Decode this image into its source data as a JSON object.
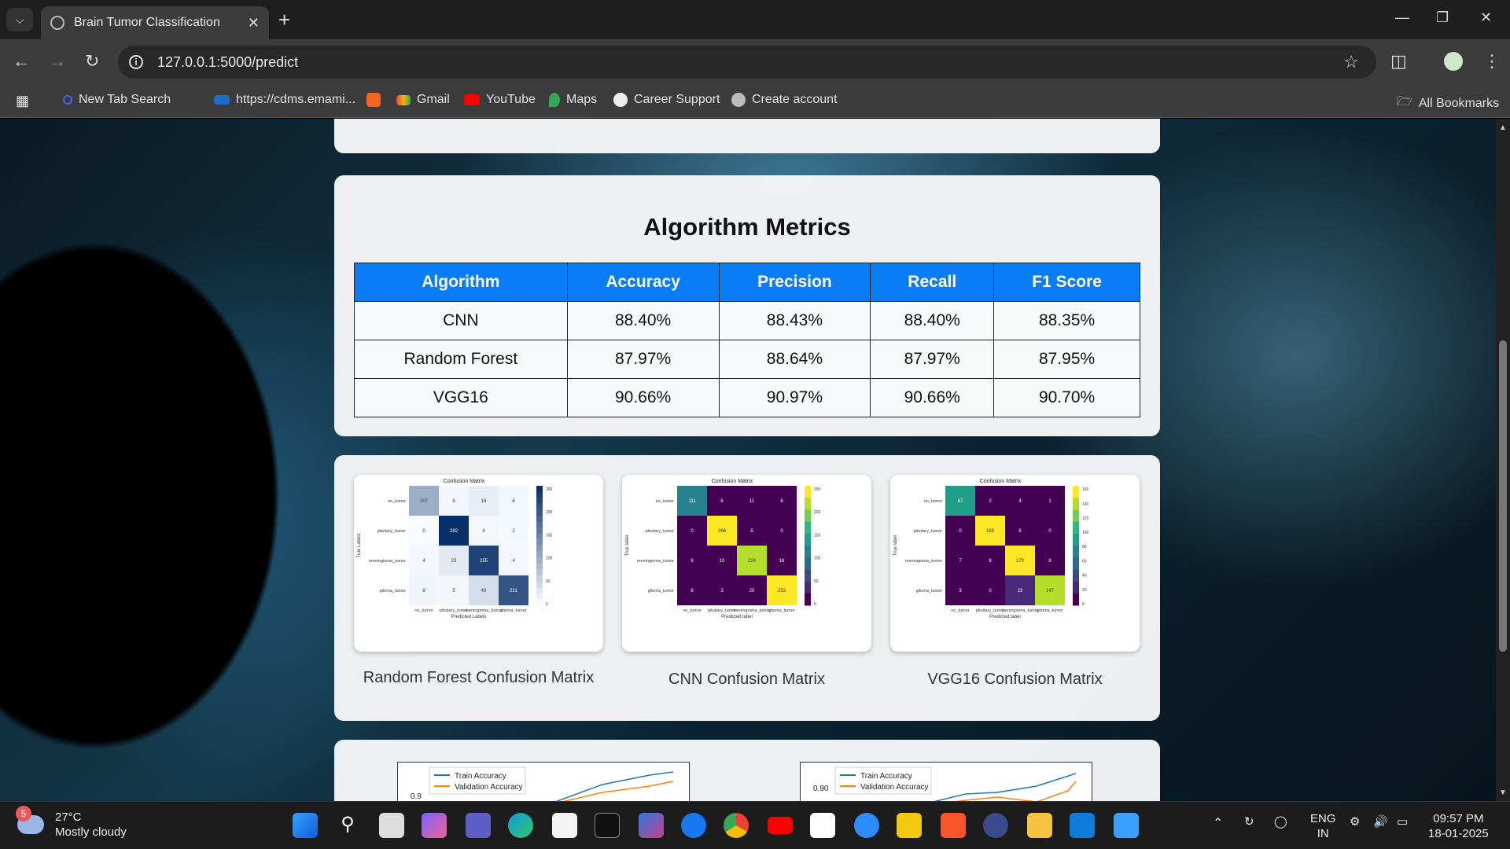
{
  "browser": {
    "tab_title": "Brain Tumor Classification",
    "url": "127.0.0.1:5000/predict",
    "bookmarks": [
      "New Tab Search",
      "https://cdms.emami...",
      "Gmail",
      "YouTube",
      "Maps",
      "Career Support",
      "Create account"
    ],
    "all_bookmarks": "All Bookmarks"
  },
  "metrics": {
    "title": "Algorithm Metrics",
    "headers": [
      "Algorithm",
      "Accuracy",
      "Precision",
      "Recall",
      "F1 Score"
    ],
    "rows": [
      [
        "CNN",
        "88.40%",
        "88.43%",
        "88.40%",
        "88.35%"
      ],
      [
        "Random Forest",
        "87.97%",
        "88.64%",
        "87.97%",
        "87.95%"
      ],
      [
        "VGG16",
        "90.66%",
        "90.97%",
        "90.66%",
        "90.70%"
      ]
    ]
  },
  "confusion_matrices": [
    {
      "caption": "Random Forest Confusion Matrix",
      "title": "Confusion Matrix",
      "labels": [
        "no_tumor",
        "pituitary_tumor",
        "meningioma_tumor",
        "glioma_tumor"
      ],
      "xlabel": "Predicted Labels",
      "ylabel": "True Labels",
      "cmap": "blues",
      "values": [
        [
          107,
          5,
          18,
          6
        ],
        [
          0,
          282,
          4,
          2
        ],
        [
          4,
          23,
          255,
          4
        ],
        [
          8,
          5,
          40,
          231
        ]
      ],
      "ticks": [
        "250",
        "200",
        "150",
        "100",
        "50",
        "0"
      ]
    },
    {
      "caption": "CNN Confusion Matrix",
      "title": "Confusion Matrix",
      "labels": [
        "no_tumor",
        "pituitary_tumor",
        "meningioma_tumor",
        "glioma_tumor"
      ],
      "xlabel": "Predicted label",
      "ylabel": "True label",
      "cmap": "viridis",
      "values": [
        [
          111,
          6,
          11,
          6
        ],
        [
          0,
          266,
          5,
          0
        ],
        [
          9,
          10,
          224,
          18
        ],
        [
          8,
          3,
          20,
          253
        ]
      ],
      "ticks": [
        "250",
        "200",
        "150",
        "100",
        "50",
        "0"
      ]
    },
    {
      "caption": "VGG16 Confusion Matrix",
      "title": "Confusion Matrix",
      "labels": [
        "no_tumor",
        "pituitary_tumor",
        "meningioma_tumor",
        "glioma_tumor"
      ],
      "xlabel": "Predicted label",
      "ylabel": "True label",
      "cmap": "viridis",
      "values": [
        [
          87,
          2,
          4,
          1
        ],
        [
          0,
          169,
          8,
          0
        ],
        [
          7,
          8,
          170,
          8
        ],
        [
          3,
          0,
          23,
          147
        ]
      ],
      "ticks": [
        "160",
        "140",
        "120",
        "100",
        "80",
        "60",
        "40",
        "20",
        "0"
      ]
    }
  ],
  "accuracy_plots": [
    {
      "legend": [
        "Train Accuracy",
        "Validation Accuracy"
      ],
      "ytick": "0.9"
    },
    {
      "legend": [
        "Train Accuracy",
        "Validation Accuracy"
      ],
      "ytick": "0.90"
    }
  ],
  "taskbar": {
    "temp": "27°C",
    "weather": "Mostly cloudy",
    "weather_badge": "5",
    "lang_1": "ENG",
    "lang_2": "IN",
    "time": "09:57 PM",
    "date": "18-01-2025"
  }
}
